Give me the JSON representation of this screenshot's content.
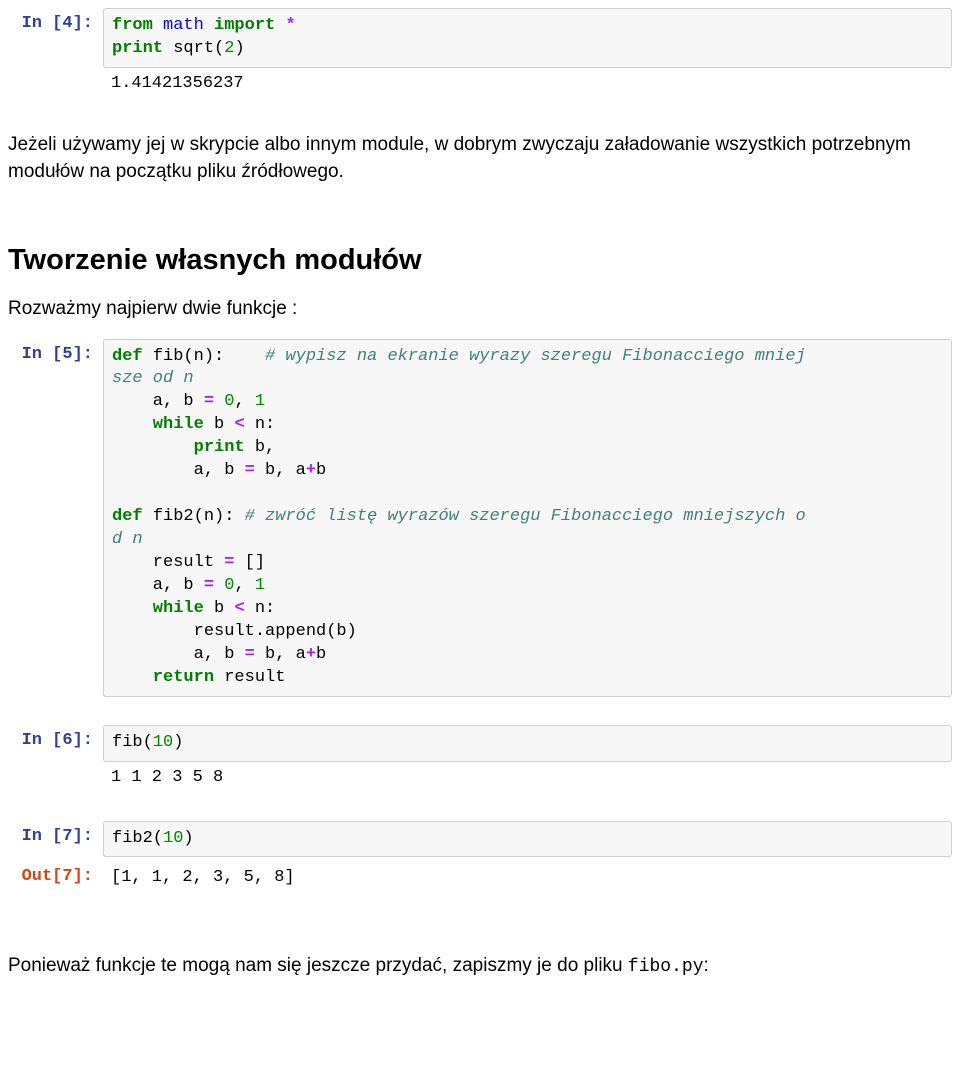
{
  "cells": {
    "c4": {
      "prompt": "In [4]:",
      "code": {
        "line1": {
          "t1": "from ",
          "t2": "math",
          "t3": " import ",
          "t4": "*"
        },
        "line2": {
          "t1": "print ",
          "t2": "sqrt(",
          "t3": "2",
          "t4": ")"
        }
      },
      "output": "1.41421356237"
    },
    "prose1": "Jeżeli używamy jej w skrypcie albo innym module, w dobrym zwyczaju załadowanie wszystkich potrzebnym modułów na początku pliku źródłowego.",
    "heading1": "Tworzenie własnych modułów",
    "prose2": "Rozważmy najpierw dwie funkcje :",
    "c5": {
      "prompt": "In [5]:",
      "code": {
        "l1": {
          "t1": "def ",
          "t2": "fib(n):    ",
          "t3": "# wypisz na ekranie wyrazy szeregu Fibonacciego mniej"
        },
        "l1b": {
          "t1": "sze od n"
        },
        "l2": {
          "t1": "    a, b ",
          "t2": "= ",
          "t3": "0",
          "t4": ", ",
          "t5": "1"
        },
        "l3": {
          "t1": "    while ",
          "t2": "b ",
          "t3": "< ",
          "t4": "n:"
        },
        "l4": {
          "t1": "        print ",
          "t2": "b,"
        },
        "l5": {
          "t1": "        a, b ",
          "t2": "= ",
          "t3": "b, a",
          "t4": "+",
          "t5": "b"
        },
        "blank1": " ",
        "l6": {
          "t1": "def ",
          "t2": "fib2(n): ",
          "t3": "# zwróć listę wyrazów szeregu Fibonacciego mniejszych o"
        },
        "l6b": {
          "t1": "d n"
        },
        "l7": {
          "t1": "    result ",
          "t2": "= ",
          "t3": "[]"
        },
        "l8": {
          "t1": "    a, b ",
          "t2": "= ",
          "t3": "0",
          "t4": ", ",
          "t5": "1"
        },
        "l9": {
          "t1": "    while ",
          "t2": "b ",
          "t3": "< ",
          "t4": "n:"
        },
        "l10": {
          "t1": "        result.append(b)"
        },
        "l11": {
          "t1": "        a, b ",
          "t2": "= ",
          "t3": "b, a",
          "t4": "+",
          "t5": "b"
        },
        "l12": {
          "t1": "    return ",
          "t2": "result"
        }
      }
    },
    "c6": {
      "prompt": "In [6]:",
      "code": {
        "t1": "fib(",
        "t2": "10",
        "t3": ")"
      },
      "output": "1 1 2 3 5 8"
    },
    "c7": {
      "prompt": "In [7]:",
      "code": {
        "t1": "fib2(",
        "t2": "10",
        "t3": ")"
      },
      "out_prompt": "Out[7]:",
      "out_value": "[1, 1, 2, 3, 5, 8]"
    },
    "prose3": {
      "p1": "Ponieważ funkcje te mogą nam się jeszcze przydać, zapiszmy je do pliku ",
      "code": "fibo.py",
      "p2": ":"
    }
  }
}
